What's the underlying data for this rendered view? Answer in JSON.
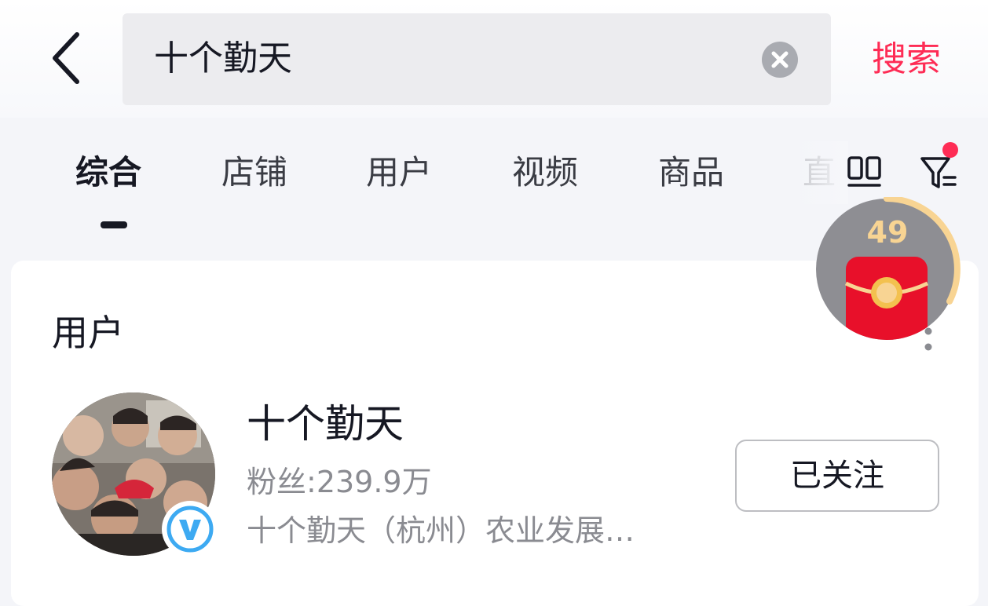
{
  "search": {
    "query": "十个勤天",
    "button_label": "搜索"
  },
  "tabs": [
    {
      "label": "综合",
      "active": true
    },
    {
      "label": "店铺"
    },
    {
      "label": "用户"
    },
    {
      "label": "视频"
    },
    {
      "label": "商品"
    },
    {
      "label": "直"
    }
  ],
  "section": {
    "title": "用户"
  },
  "user": {
    "name": "十个勤天",
    "fans_label": "粉丝:",
    "fans_count": "239.9万",
    "description": "十个勤天（杭州）农业发展…",
    "follow_label": "已关注",
    "verified": true
  },
  "widget": {
    "count": "49"
  },
  "colors": {
    "accent": "#fe2c55",
    "text_primary": "#161823",
    "text_secondary": "#8a8b91",
    "verify_blue": "#3daaf2",
    "widget_gold": "#f8d493",
    "widget_red": "#e8102a"
  },
  "icons": {
    "back": "chevron-left-icon",
    "clear": "clear-circle-icon",
    "grid": "double-column-icon",
    "filter": "filter-icon",
    "more": "more-vertical-icon",
    "verified": "verified-v-icon",
    "red_packet": "red-packet-icon"
  }
}
